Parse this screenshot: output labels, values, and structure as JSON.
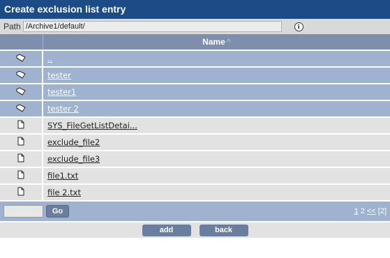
{
  "window": {
    "title": "Create exclusion list entry"
  },
  "path": {
    "label": "Path",
    "value": "/Archive1/default/",
    "info_icon": "info-icon",
    "info_glyph": "i"
  },
  "table": {
    "column_header": "Name",
    "sort_arrow": "^",
    "rows": [
      {
        "type": "folder",
        "icon": "folder-icon",
        "name": ".."
      },
      {
        "type": "folder",
        "icon": "folder-icon",
        "name": "tester"
      },
      {
        "type": "folder",
        "icon": "folder-icon",
        "name": "tester1"
      },
      {
        "type": "folder",
        "icon": "folder-icon",
        "name": "tester 2"
      },
      {
        "type": "file",
        "icon": "file-icon",
        "name": "SYS_FileGetListDetai..."
      },
      {
        "type": "file",
        "icon": "file-icon",
        "name": "exclude_file2"
      },
      {
        "type": "file",
        "icon": "file-icon",
        "name": "exclude_file3"
      },
      {
        "type": "file",
        "icon": "file-icon",
        "name": "file1.txt"
      },
      {
        "type": "file",
        "icon": "file-icon",
        "name": "file 2.txt"
      }
    ]
  },
  "pagination": {
    "go_label": "Go",
    "page1": "1",
    "page2": "2",
    "prev": "<<",
    "total": "[2]"
  },
  "actions": {
    "add_label": "add",
    "back_label": "back"
  },
  "colors": {
    "title_bar": "#1c4b86",
    "header": "#7d8fad",
    "folder_row": "#9fb3d1",
    "file_row": "#e2e2e2",
    "button": "#6a7f9e"
  }
}
